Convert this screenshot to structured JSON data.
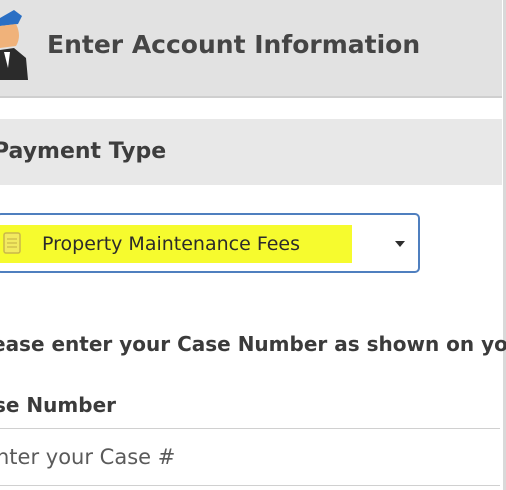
{
  "header": {
    "title": "Enter Account Information",
    "avatar_icon": "user-avatar-icon"
  },
  "payment_section": {
    "title": "Payment Type"
  },
  "payment_select": {
    "selected": "Property Maintenance Fees",
    "icon": "document-icon",
    "highlight_color": "#f6fb2e",
    "border_color": "#4f7fbf"
  },
  "case": {
    "instruction": "ease enter your Case Number as shown on you",
    "label": "se Number",
    "placeholder": "nter your Case #"
  }
}
